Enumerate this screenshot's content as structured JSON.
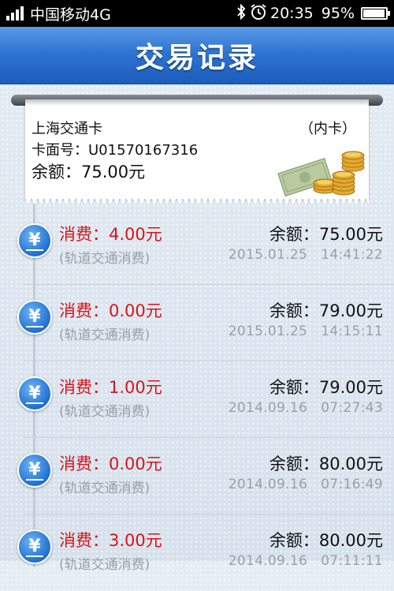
{
  "status_bar": {
    "carrier": "中国移动4G",
    "time": "20:35",
    "battery": "95%",
    "battery_level": 0.95,
    "icons": [
      "signal-icon",
      "bluetooth-icon",
      "alarm-icon",
      "battery-icon"
    ]
  },
  "header": {
    "title": "交易记录"
  },
  "card": {
    "name": "上海交通卡",
    "type": "（内卡）",
    "number": "卡面号：U01570167316",
    "balance": "余额：75.00元",
    "icon": "money-icon"
  },
  "records": [
    {
      "amount": "消费：4.00元",
      "type": "(轨道交通消费)",
      "balance": "余额：75.00元",
      "date": "2015.01.25",
      "time": "14:41:22"
    },
    {
      "amount": "消费：0.00元",
      "type": "(轨道交通消费)",
      "balance": "余额：79.00元",
      "date": "2015.01.25",
      "time": "14:15:11"
    },
    {
      "amount": "消费：1.00元",
      "type": "(轨道交通消费)",
      "balance": "余额：79.00元",
      "date": "2014.09.16",
      "time": "07:27:43"
    },
    {
      "amount": "消费：0.00元",
      "type": "(轨道交通消费)",
      "balance": "余额：80.00元",
      "date": "2014.09.16",
      "time": "07:16:49"
    },
    {
      "amount": "消费：3.00元",
      "type": "(轨道交通消费)",
      "balance": "余额：80.00元",
      "date": "2014.09.16",
      "time": "07:11:11"
    }
  ],
  "colors": {
    "accent": "#2f74d2",
    "expense": "#d8141a",
    "muted": "#9aa0a8"
  }
}
